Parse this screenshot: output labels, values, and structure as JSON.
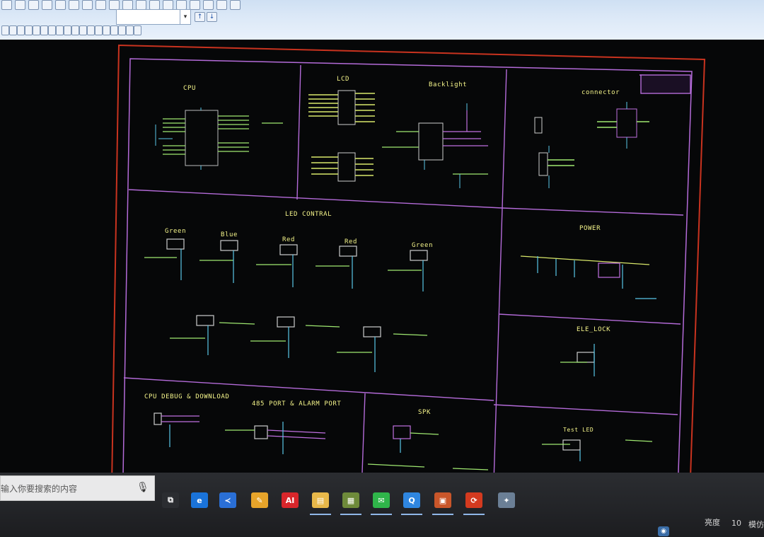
{
  "toolbar": {
    "row1": [
      "new",
      "open",
      "save",
      "print",
      "cut",
      "copy",
      "paste",
      "undo",
      "redo",
      "zoom",
      "find",
      "place",
      "wire",
      "bus",
      "net",
      "part",
      "pin",
      "text"
    ],
    "row2": [
      "select",
      "move",
      "rotate",
      "mirror",
      "align",
      "group",
      "ungroup",
      "delete",
      "measure",
      "snap",
      "grid",
      "layer",
      "place-part",
      "place-wire",
      "place-net",
      "place-port",
      "place-power",
      "place-text"
    ],
    "nav_arrows": [
      "↑",
      "↓"
    ]
  },
  "schematic": {
    "blocks": [
      {
        "id": "cpu",
        "title": "CPU"
      },
      {
        "id": "lcd",
        "title": "LCD"
      },
      {
        "id": "backlight",
        "title": "Backlight"
      },
      {
        "id": "connector",
        "title": "connector"
      },
      {
        "id": "led-control",
        "title": "LED CONTRAL"
      },
      {
        "id": "power",
        "title": "POWER"
      },
      {
        "id": "ele-lock",
        "title": "ELE_LOCK"
      },
      {
        "id": "cpu-debug",
        "title": "CPU DEBUG & DOWNLOAD"
      },
      {
        "id": "port485",
        "title": "485 PORT & ALARM PORT"
      },
      {
        "id": "spk",
        "title": "SPK"
      },
      {
        "id": "test-led",
        "title": "Test LED"
      }
    ],
    "led_labels": [
      "Green",
      "Blue",
      "Red",
      "Red",
      "Green"
    ]
  },
  "taskbar": {
    "search_placeholder": "输入你要搜索的内容",
    "apps": [
      {
        "icon": "task-view-icon",
        "glyph": "⧉",
        "color": "#2b2d31"
      },
      {
        "icon": "edge-icon",
        "glyph": "e",
        "color": "#1a73d9"
      },
      {
        "icon": "thunder-icon",
        "glyph": "≺",
        "color": "#2a6fd6"
      },
      {
        "icon": "sticky-note-icon",
        "glyph": "✎",
        "color": "#e7a42a"
      },
      {
        "icon": "red-app-icon",
        "glyph": "AI",
        "color": "#d8262b"
      },
      {
        "icon": "file-explorer-icon",
        "glyph": "▤",
        "color": "#e8b84a"
      },
      {
        "icon": "pcb-app-icon",
        "glyph": "▦",
        "color": "#6e8a3a"
      },
      {
        "icon": "wechat-icon",
        "glyph": "✉",
        "color": "#2fb54a"
      },
      {
        "icon": "qq-browser-icon",
        "glyph": "Q",
        "color": "#2f86e0"
      },
      {
        "icon": "schematic-app-icon",
        "glyph": "▣",
        "color": "#c9562a"
      },
      {
        "icon": "browser-red-icon",
        "glyph": "⟳",
        "color": "#d43a1f"
      },
      {
        "icon": "tool-app-icon",
        "glyph": "✦",
        "color": "#6b7f96"
      }
    ],
    "tray": {
      "left": "亮度",
      "value": "10",
      "right": "模仿"
    }
  }
}
